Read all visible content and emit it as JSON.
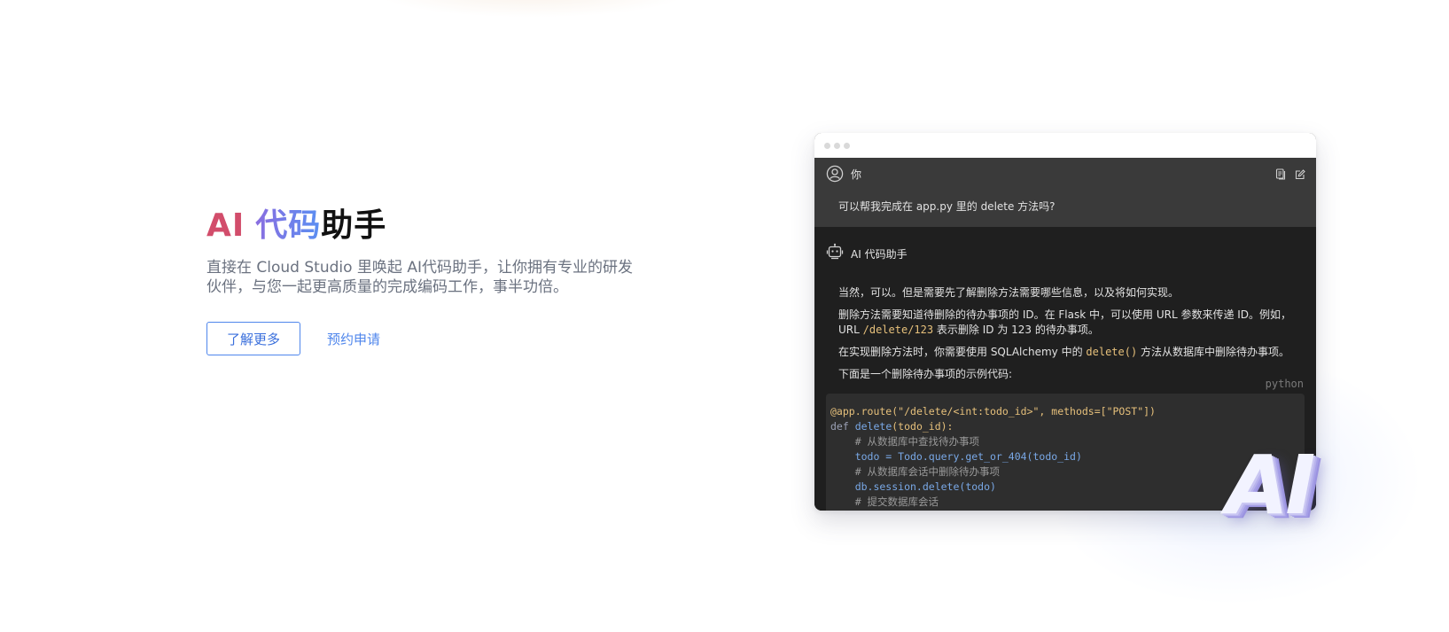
{
  "hero": {
    "title_ai": "AI",
    "title_code": "代码",
    "title_helper": "助手",
    "description": "直接在 Cloud Studio 里唤起 AI代码助手，让你拥有专业的研发伙伴，与您一起更高质量的完成编码工作，事半功倍。",
    "learn_more": "了解更多",
    "apply": "预约申请"
  },
  "window": {
    "user": {
      "name": "你",
      "question": "可以帮我完成在 app.py 里的 delete 方法吗?"
    },
    "bot": {
      "name": "AI 代码助手",
      "p1": "当然，可以。但是需要先了解删除方法需要哪些信息，以及将如何实现。",
      "p2_a": "删除方法需要知道待删除的待办事项的 ID。在 Flask 中，可以使用 URL 参数来传递 ID。例如，URL ",
      "p2_code": "/delete/123",
      "p2_b": " 表示删除 ID 为 123 的待办事项。",
      "p3_a": "在实现删除方法时，你需要使用 SQLAlchemy 中的 ",
      "p3_code": "delete()",
      "p3_b": " 方法从数据库中删除待办事项。",
      "p4": "下面是一个删除待办事项的示例代码:",
      "lang": "python"
    },
    "code": {
      "l1_dec": "@app.route(",
      "l1_str": "\"/delete/<int:todo_id>\"",
      "l1_rest": ", methods=[\"POST\"])",
      "l2_kw": "def ",
      "l2_fn": "delete",
      "l2_rest": "(todo_id):",
      "l3": "    # 从数据库中查找待办事项",
      "l4": "    todo = Todo.query.get_or_404(todo_id)",
      "l5": "    # 从数据库会话中删除待办事项",
      "l6": "    db.session.delete(todo)",
      "l7": "    # 提交数据库会话"
    }
  },
  "logo": {
    "text": "AI"
  }
}
